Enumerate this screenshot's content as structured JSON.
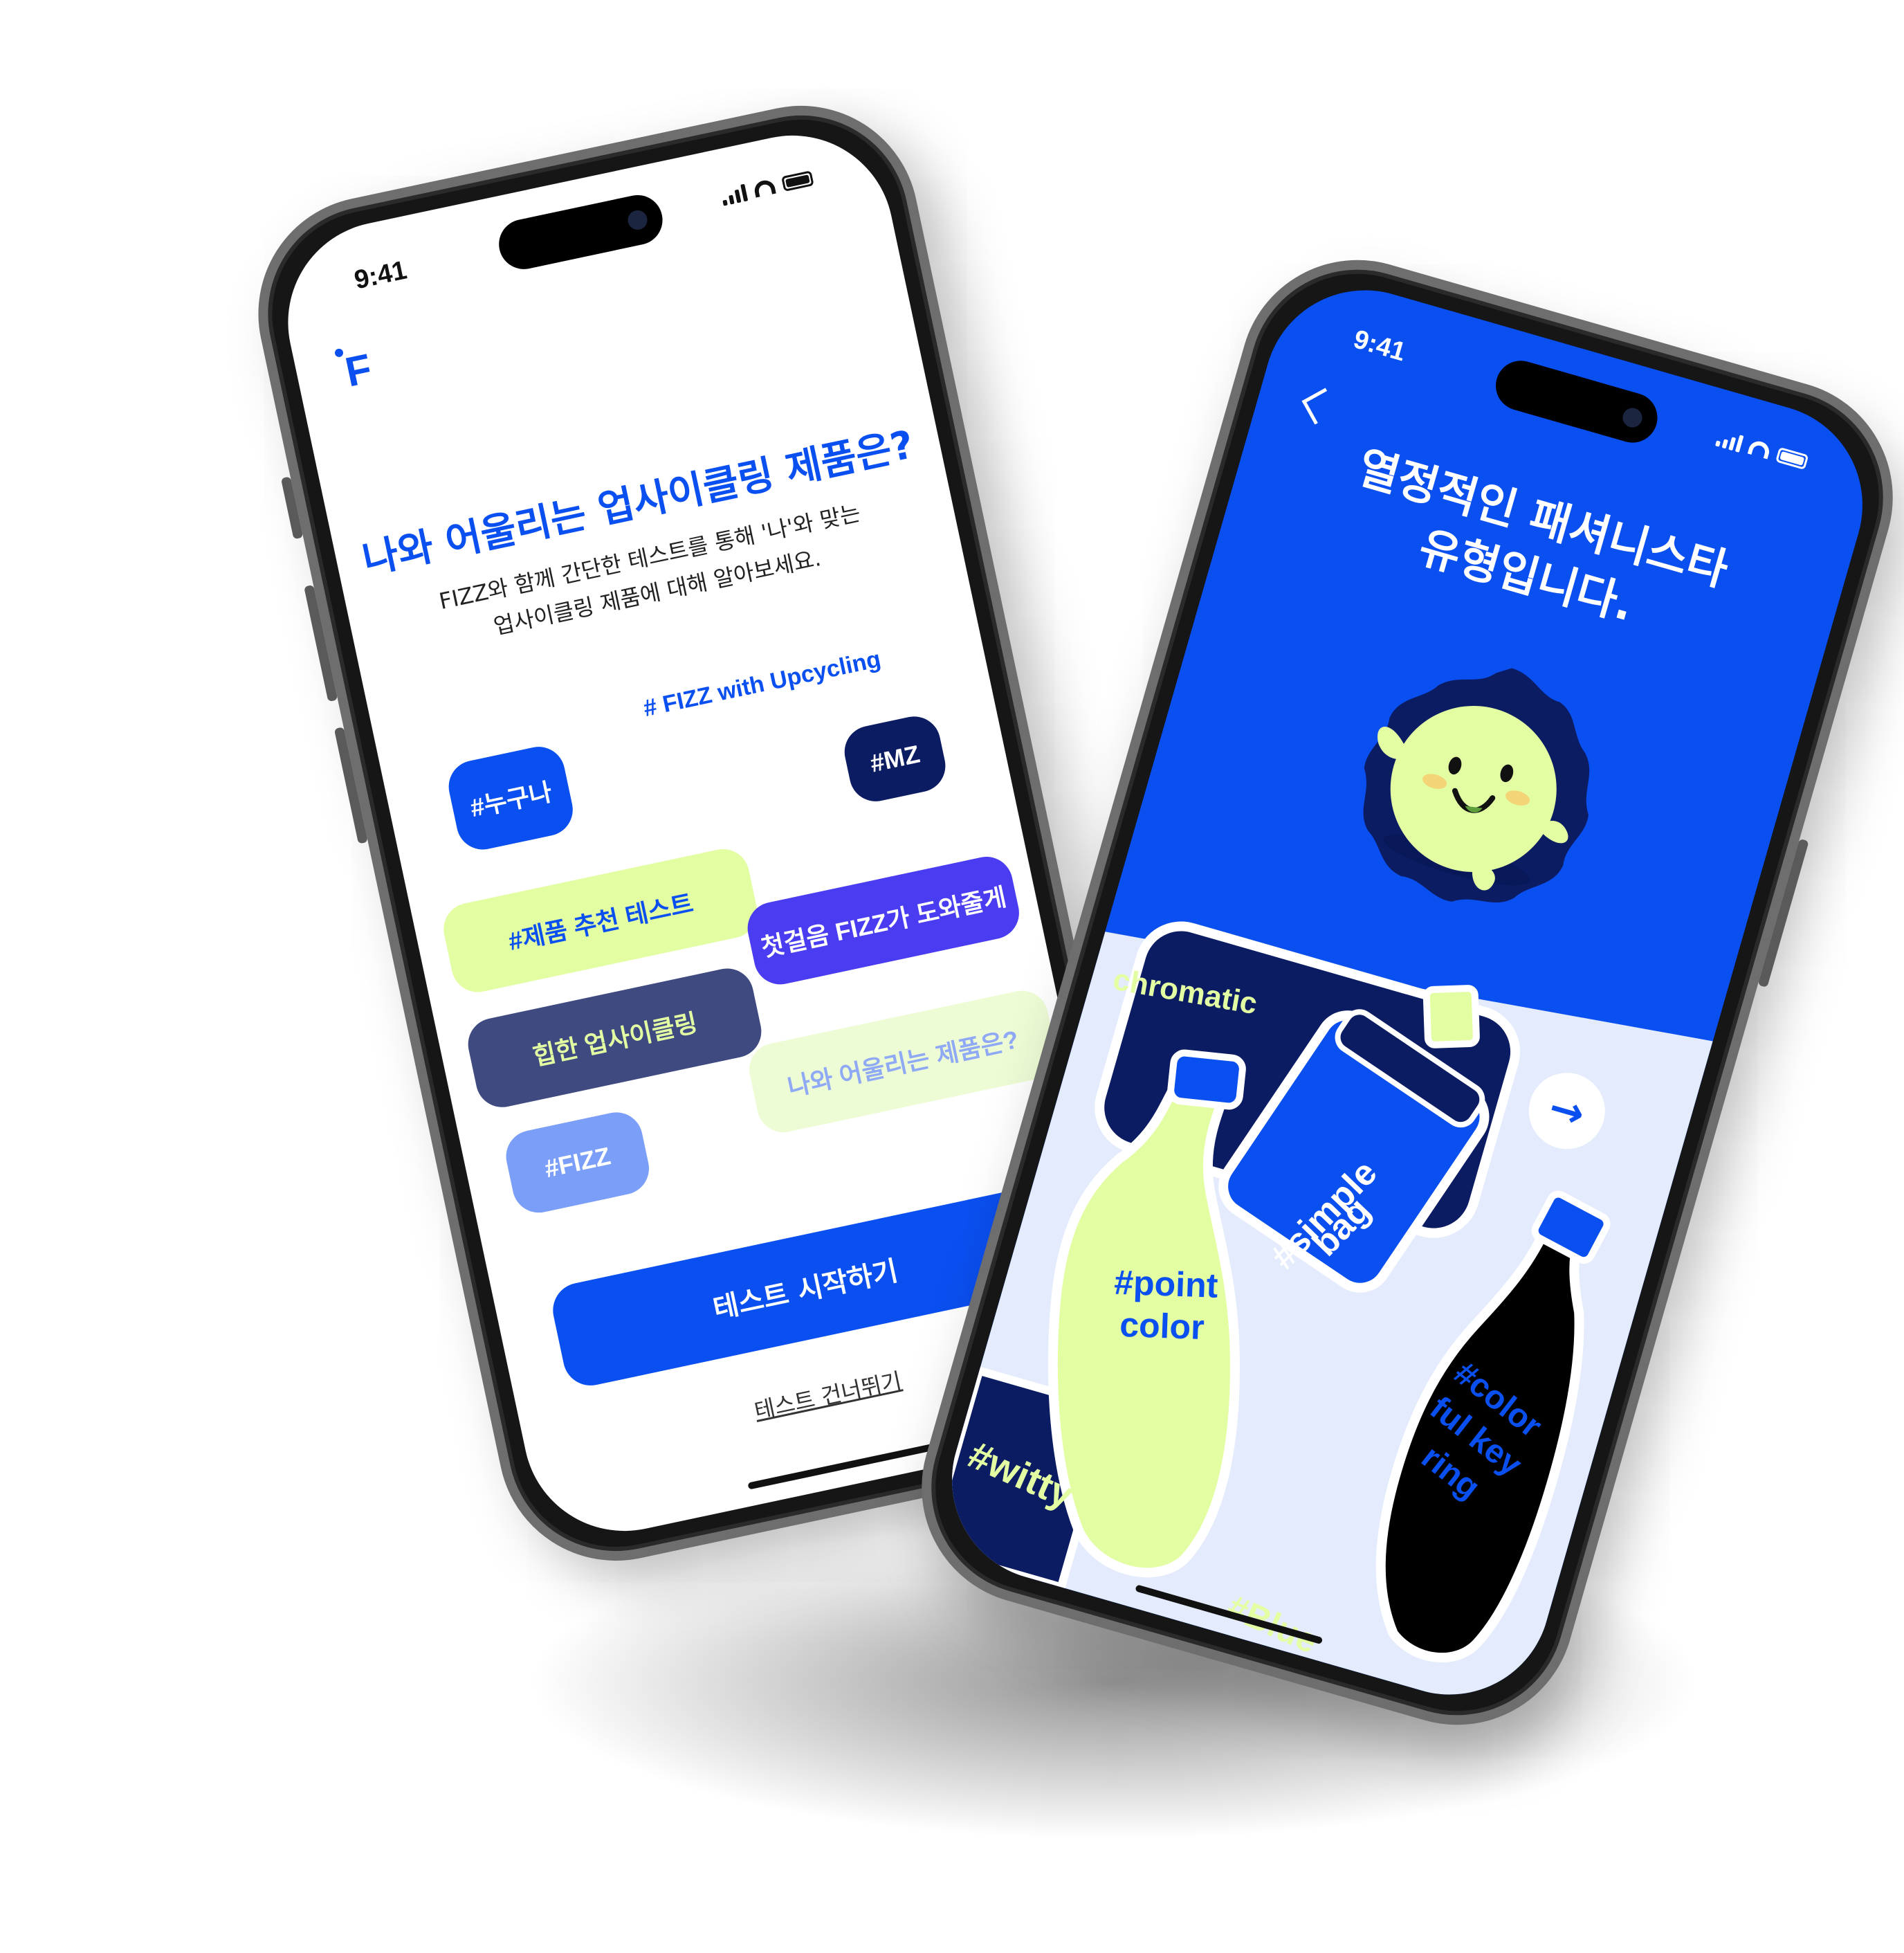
{
  "colors": {
    "brand_blue": "#0a4ff0",
    "lime": "#e3fda3",
    "navy": "#0b1c63",
    "slate": "#3f4a80",
    "purple": "#4a3cf0",
    "light_blue": "#7b9ef8",
    "pale_lime": "#eefcd6",
    "pale_lime_text": "#8fa9f5"
  },
  "phone1": {
    "status": {
      "time": "9:41"
    },
    "logo": "F",
    "title": "나와 어울리는 업사이클링 제품은?",
    "description_line1": "FIZZ와 함께 간단한 테스트를 통해 '나'와 맞는",
    "description_line2": "업사이클링 제품에 대해 알아보세요.",
    "hashtag_caption": "# FIZZ with Upcycling",
    "tags": [
      {
        "label": "#누구나"
      },
      {
        "label": "#MZ"
      },
      {
        "label": "#제품 추천 테스트"
      },
      {
        "label": "첫걸음 FIZZ가 도와줄게"
      },
      {
        "label": "힙한 업사이클링"
      },
      {
        "label": "나와 어울리는 제품은?"
      },
      {
        "label": "#FIZZ"
      }
    ],
    "start_button": "테스트 시작하기",
    "skip_link": "테스트 건너뛰기"
  },
  "phone2": {
    "status": {
      "time": "9:41"
    },
    "title_line1": "열정적인 패셔니스타",
    "title_line2": "유형입니다.",
    "icons": {
      "back": "chevron-left-icon",
      "next": "arrow-right-icon"
    },
    "stickers": {
      "achromatic": "chromatic",
      "simple_bag_1": "#simple",
      "simple_bag_2": "bag",
      "point_color_1": "#point",
      "point_color_2": "color",
      "keyring_1": "#color",
      "keyring_2": "ful key",
      "keyring_3": "ring",
      "witty": "#witty",
      "blue": "#Blue"
    }
  }
}
